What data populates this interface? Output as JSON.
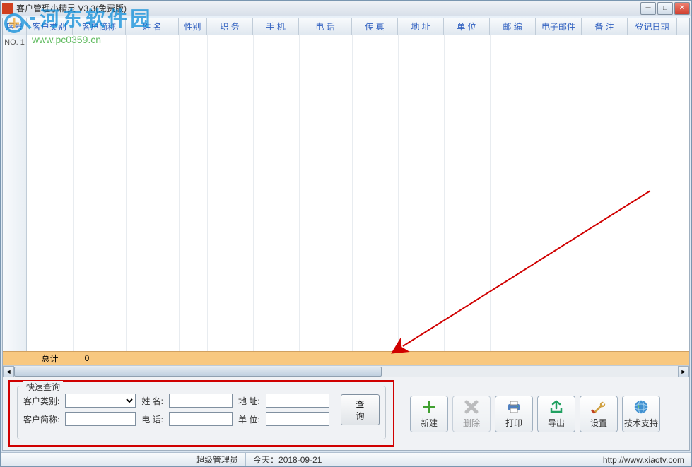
{
  "window": {
    "title": "客户管理小精灵 V3.3(免费版)"
  },
  "watermark": {
    "text": "河东软件园",
    "url": "www.pc0359.cn"
  },
  "table": {
    "headers": [
      "序号",
      "客户类别",
      "客户简称",
      "姓  名",
      "性别",
      "职  务",
      "手  机",
      "电  话",
      "传  真",
      "地  址",
      "单  位",
      "邮  编",
      "电子邮件",
      "备  注",
      "登记日期"
    ],
    "row_label": "NO. 1",
    "total_label": "总计",
    "total_value": "0"
  },
  "search": {
    "legend": "快速查询",
    "labels": {
      "category": "客户类别:",
      "shortname": "客户简称:",
      "name": "姓  名:",
      "phone": "电  话:",
      "address": "地  址:",
      "unit": "单  位:"
    },
    "button": "查 询"
  },
  "actions": {
    "new": "新建",
    "delete": "删除",
    "print": "打印",
    "export": "导出",
    "settings": "设置",
    "support": "技术支持"
  },
  "status": {
    "user": "超级管理员",
    "date_label": "今天：",
    "date": "2018-09-21",
    "url": "http://www.xiaotv.com"
  }
}
